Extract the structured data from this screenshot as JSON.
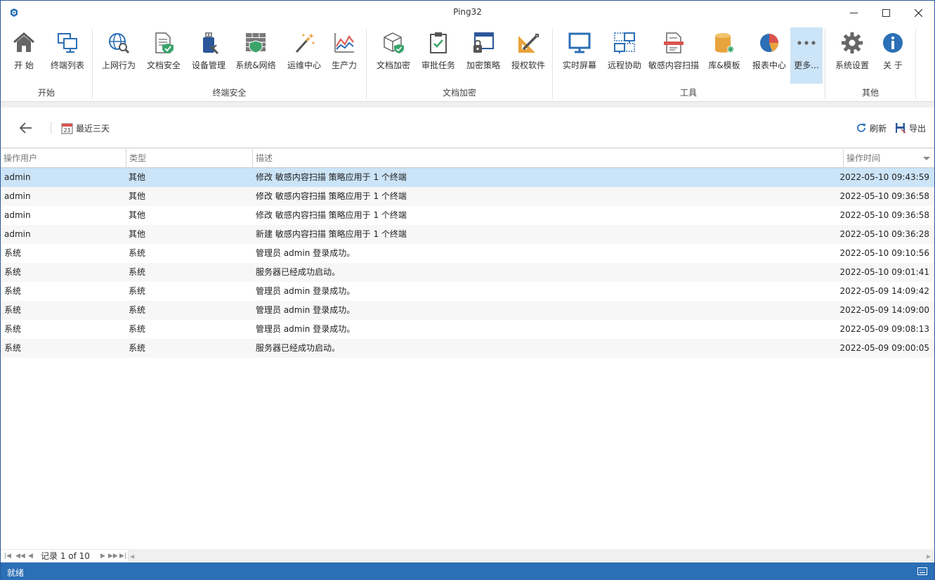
{
  "window": {
    "title": "Ping32"
  },
  "ribbon": {
    "groups": [
      {
        "label": "开始",
        "items": [
          {
            "label": "开 始",
            "icon": "home-icon"
          },
          {
            "label": "终端列表",
            "icon": "computers-icon"
          }
        ]
      },
      {
        "label": "终端安全",
        "items": [
          {
            "label": "上网行为",
            "icon": "globe-search-icon"
          },
          {
            "label": "文档安全",
            "icon": "document-shield-icon"
          },
          {
            "label": "设备管理",
            "icon": "usb-device-icon"
          },
          {
            "label": "系统&网络",
            "icon": "firewall-icon"
          },
          {
            "label": "运维中心",
            "icon": "magic-wand-icon"
          },
          {
            "label": "生产力",
            "icon": "chart-line-icon"
          }
        ]
      },
      {
        "label": "文档加密",
        "items": [
          {
            "label": "文档加密",
            "icon": "cube-shield-icon"
          },
          {
            "label": "审批任务",
            "icon": "clipboard-check-icon"
          },
          {
            "label": "加密策略",
            "icon": "window-lock-icon"
          },
          {
            "label": "授权软件",
            "icon": "ruler-pencil-icon"
          }
        ]
      },
      {
        "label": "工具",
        "items": [
          {
            "label": "实时屏幕",
            "icon": "monitor-icon"
          },
          {
            "label": "远程协助",
            "icon": "remote-icon"
          },
          {
            "label": "敏感内容扫描",
            "icon": "document-scan-icon"
          },
          {
            "label": "库&模板",
            "icon": "database-icon"
          },
          {
            "label": "报表中心",
            "icon": "pie-chart-icon"
          },
          {
            "label": "更多...",
            "icon": "more-dots-icon"
          }
        ]
      },
      {
        "label": "其他",
        "items": [
          {
            "label": "系统设置",
            "icon": "gear-icon"
          },
          {
            "label": "关 于",
            "icon": "info-icon"
          }
        ]
      }
    ]
  },
  "toolbar": {
    "range_label": "最近三天",
    "refresh_label": "刷新",
    "export_label": "导出"
  },
  "grid": {
    "columns": [
      "操作用户",
      "类型",
      "描述",
      "操作时间"
    ],
    "rows": [
      {
        "user": "admin",
        "type": "其他",
        "desc": "修改 敏感内容扫描 策略应用于 1 个终端",
        "time": "2022-05-10 09:43:59"
      },
      {
        "user": "admin",
        "type": "其他",
        "desc": "修改 敏感内容扫描 策略应用于 1 个终端",
        "time": "2022-05-10 09:36:58"
      },
      {
        "user": "admin",
        "type": "其他",
        "desc": "修改 敏感内容扫描 策略应用于 1 个终端",
        "time": "2022-05-10 09:36:58"
      },
      {
        "user": "admin",
        "type": "其他",
        "desc": "新建 敏感内容扫描 策略应用于 1 个终端",
        "time": "2022-05-10 09:36:28"
      },
      {
        "user": "系统",
        "type": "系统",
        "desc": "管理员 admin 登录成功。",
        "time": "2022-05-10 09:10:56"
      },
      {
        "user": "系统",
        "type": "系统",
        "desc": "服务器已经成功启动。",
        "time": "2022-05-10 09:01:41"
      },
      {
        "user": "系统",
        "type": "系统",
        "desc": "管理员 admin 登录成功。",
        "time": "2022-05-09 14:09:42"
      },
      {
        "user": "系统",
        "type": "系统",
        "desc": "管理员 admin 登录成功。",
        "time": "2022-05-09 14:09:00"
      },
      {
        "user": "系统",
        "type": "系统",
        "desc": "管理员 admin 登录成功。",
        "time": "2022-05-09 09:08:13"
      },
      {
        "user": "系统",
        "type": "系统",
        "desc": "服务器已经成功启动。",
        "time": "2022-05-09 09:00:05"
      }
    ],
    "selected_index": 0
  },
  "pager": {
    "text": "记录 1 of 10"
  },
  "status": {
    "text": "就绪"
  },
  "colors": {
    "accent": "#2b6fb6",
    "selected": "#cce4f7"
  }
}
